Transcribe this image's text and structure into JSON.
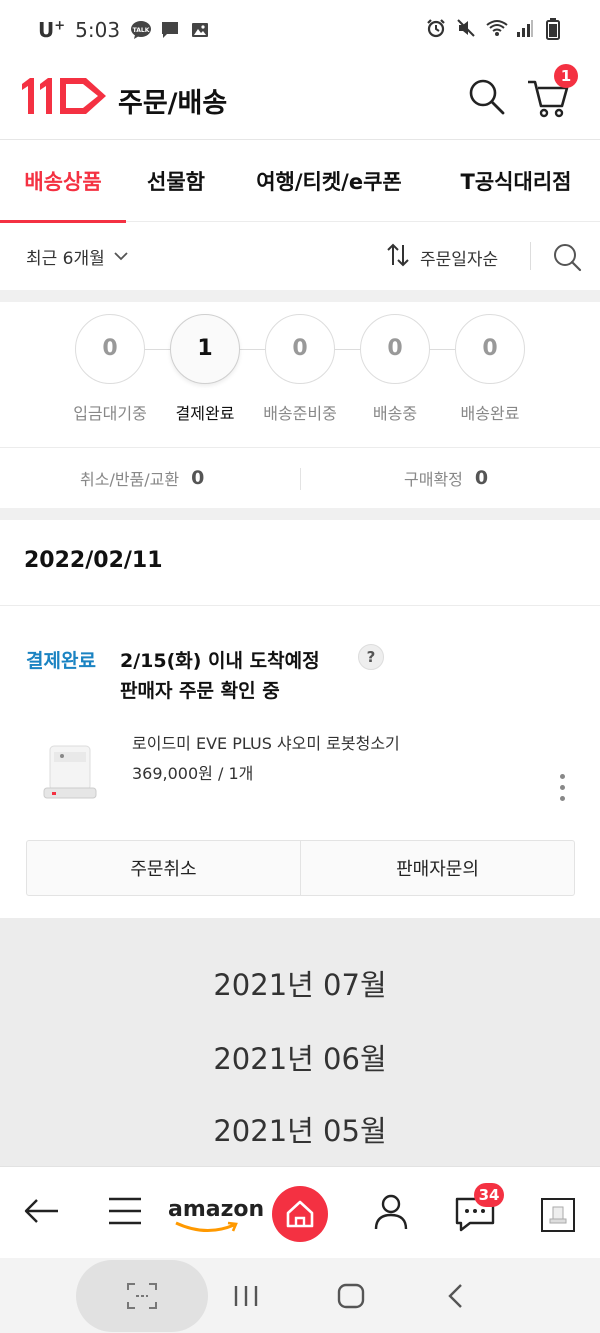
{
  "status_bar": {
    "carrier": "U",
    "carrier_sup": "+",
    "time": "5:03",
    "left_icons": [
      "talk-icon",
      "message-icon",
      "gallery-icon"
    ],
    "right_icons": [
      "alarm-icon",
      "mute-icon",
      "wifi-icon",
      "signal-icon",
      "battery-icon"
    ]
  },
  "header": {
    "logo": "11st-logo",
    "title": "주문/배송",
    "cart_count": "1"
  },
  "tabs": [
    {
      "label": "배송상품",
      "active": true
    },
    {
      "label": "선물함",
      "active": false
    },
    {
      "label": "여행/티켓/e쿠폰",
      "active": false
    },
    {
      "label": "T공식대리점",
      "active": false
    }
  ],
  "filter": {
    "period": "최근 6개월",
    "sort": "주문일자순"
  },
  "steps": [
    {
      "count": "0",
      "label": "입금대기중"
    },
    {
      "count": "1",
      "label": "결제완료",
      "active": true
    },
    {
      "count": "0",
      "label": "배송준비중"
    },
    {
      "count": "0",
      "label": "배송중"
    },
    {
      "count": "0",
      "label": "배송완료"
    }
  ],
  "claims": {
    "cancel_label": "취소/반품/교환",
    "cancel_count": "0",
    "confirm_label": "구매확정",
    "confirm_count": "0"
  },
  "order": {
    "date": "2022/02/11",
    "status": "결제완료",
    "arrival": "2/15(화) 이내 도착예정",
    "help": "?",
    "message": "판매자 주문 확인 중",
    "product_name": "로이드미 EVE PLUS 샤오미 로봇청소기",
    "product_price": "369,000원 / 1개",
    "buttons": {
      "cancel": "주문취소",
      "inquiry": "판매자문의"
    }
  },
  "months": [
    "2021년 07월",
    "2021년 06월",
    "2021년 05월"
  ],
  "bottom_nav": {
    "amazon_label": "amazon",
    "chat_count": "34"
  },
  "colors": {
    "brand_red": "#f43142",
    "status_blue": "#1a83c2"
  }
}
